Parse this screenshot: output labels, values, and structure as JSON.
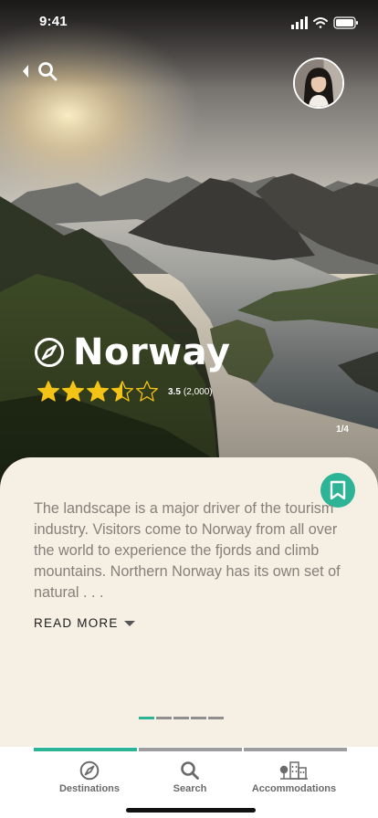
{
  "status_bar": {
    "time": "9:41"
  },
  "destination": {
    "title": "Norway",
    "rating_value": "3.5",
    "rating_count": "(2,000)",
    "rating_stars": 3.5,
    "rating_max": 5,
    "image_counter": "1/4"
  },
  "card": {
    "description": "The landscape is a major driver of the tourism industry. Visitors come to Norway from all over the world to experience the fjords and climb mountains. Northern Norway has its own set of natural . . .",
    "read_more_label": "READ MORE",
    "pager_total": 5,
    "pager_active": 0
  },
  "bottom_nav": {
    "items": [
      {
        "label": "Destinations",
        "icon": "compass-icon",
        "active": true
      },
      {
        "label": "Search",
        "icon": "search-icon",
        "active": false
      },
      {
        "label": "Accommodations",
        "icon": "buildings-icon",
        "active": false
      }
    ]
  },
  "colors": {
    "accent": "#2db395",
    "card_background": "#f6efe4",
    "star": "#f3c316",
    "body_text": "#85807a",
    "inactive_bar": "#9d9d9d"
  },
  "icons": {
    "back": "chevron-left-icon",
    "search": "search-icon",
    "destination": "compass-icon",
    "bookmark": "bookmark-icon",
    "read_more": "caret-down-icon"
  }
}
